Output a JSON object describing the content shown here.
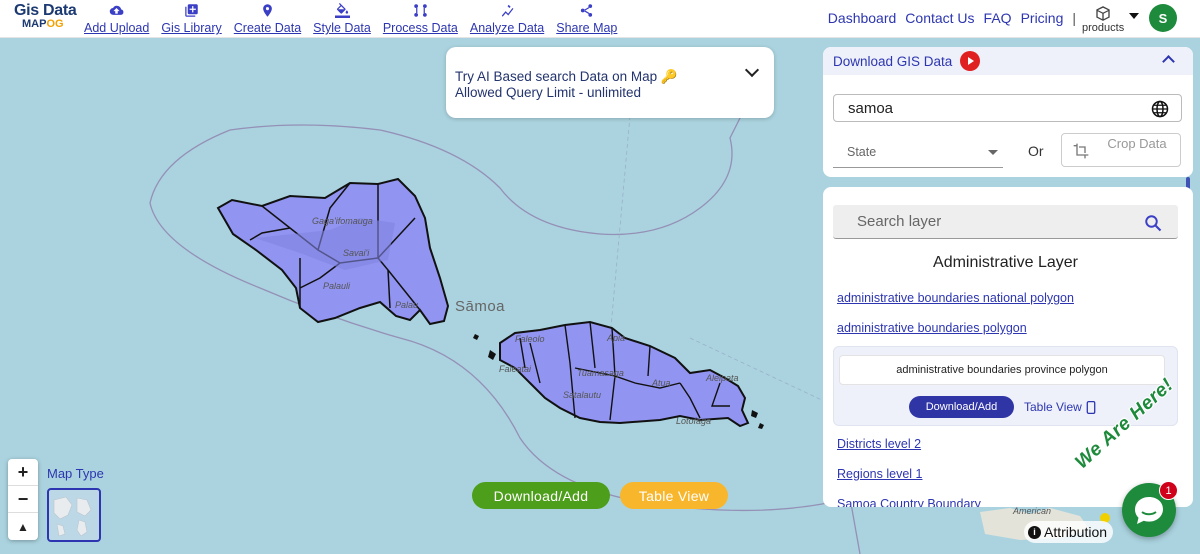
{
  "logo": {
    "line1": "Gis Data",
    "line2a": "MAP",
    "line2b": "OG"
  },
  "nav": [
    {
      "label": "Add Upload",
      "icon": "cloud-upload-icon"
    },
    {
      "label": "Gis Library",
      "icon": "library-add-icon"
    },
    {
      "label": "Create Data",
      "icon": "map-pin-icon"
    },
    {
      "label": "Style Data",
      "icon": "paint-bucket-icon"
    },
    {
      "label": "Process Data",
      "icon": "process-icon"
    },
    {
      "label": "Analyze Data",
      "icon": "analyze-icon"
    },
    {
      "label": "Share Map",
      "icon": "share-icon"
    }
  ],
  "top_right": {
    "dashboard": "Dashboard",
    "contact": "Contact Us",
    "faq": "FAQ",
    "pricing": "Pricing",
    "separator": "|",
    "products": "products",
    "avatar": "S"
  },
  "ai_box": {
    "line1": "Try AI Based search Data on Map",
    "line2": "Allowed Query Limit - unlimited",
    "key_icon": "key-icon"
  },
  "map": {
    "country_label": "Sāmoa",
    "place_labels": [
      "Gaga'ifomauga",
      "Savai'i",
      "Palauli",
      "Palau",
      "Apia",
      "Tuamasaga",
      "Faleatai",
      "Atua",
      "Lotofaga",
      "Satalautu",
      "Faleolo",
      "Aleipata",
      "American"
    ],
    "map_type_label": "Map Type",
    "zoom_in": "+",
    "zoom_out": "−",
    "reset": "▲",
    "download_btn": "Download/Add",
    "table_btn": "Table View",
    "attribution": "Attribution",
    "attribution_icon": "i"
  },
  "panel": {
    "title": "Download GIS Data",
    "country_value": "samoa",
    "state_placeholder": "State",
    "or_text": "Or",
    "crop_label": "Crop Data",
    "layer_search_placeholder": "Search layer",
    "section_title": "Administrative Layer",
    "links": [
      "administrative boundaries national polygon",
      "administrative boundaries polygon"
    ],
    "card": {
      "name": "administrative boundaries province polygon",
      "download": "Download/Add",
      "table_view": "Table View"
    },
    "more_links": [
      "Districts level 2",
      "Regions level 1",
      "Samoa Country Boundary"
    ]
  },
  "chat": {
    "badge": "1",
    "we_are_here": "We Are Here!"
  },
  "colors": {
    "accent": "#2d36b0",
    "polygon_fill": "#9194f0",
    "ocean": "#aad3df",
    "green": "#4d9e1a",
    "orange": "#f8b62d"
  }
}
